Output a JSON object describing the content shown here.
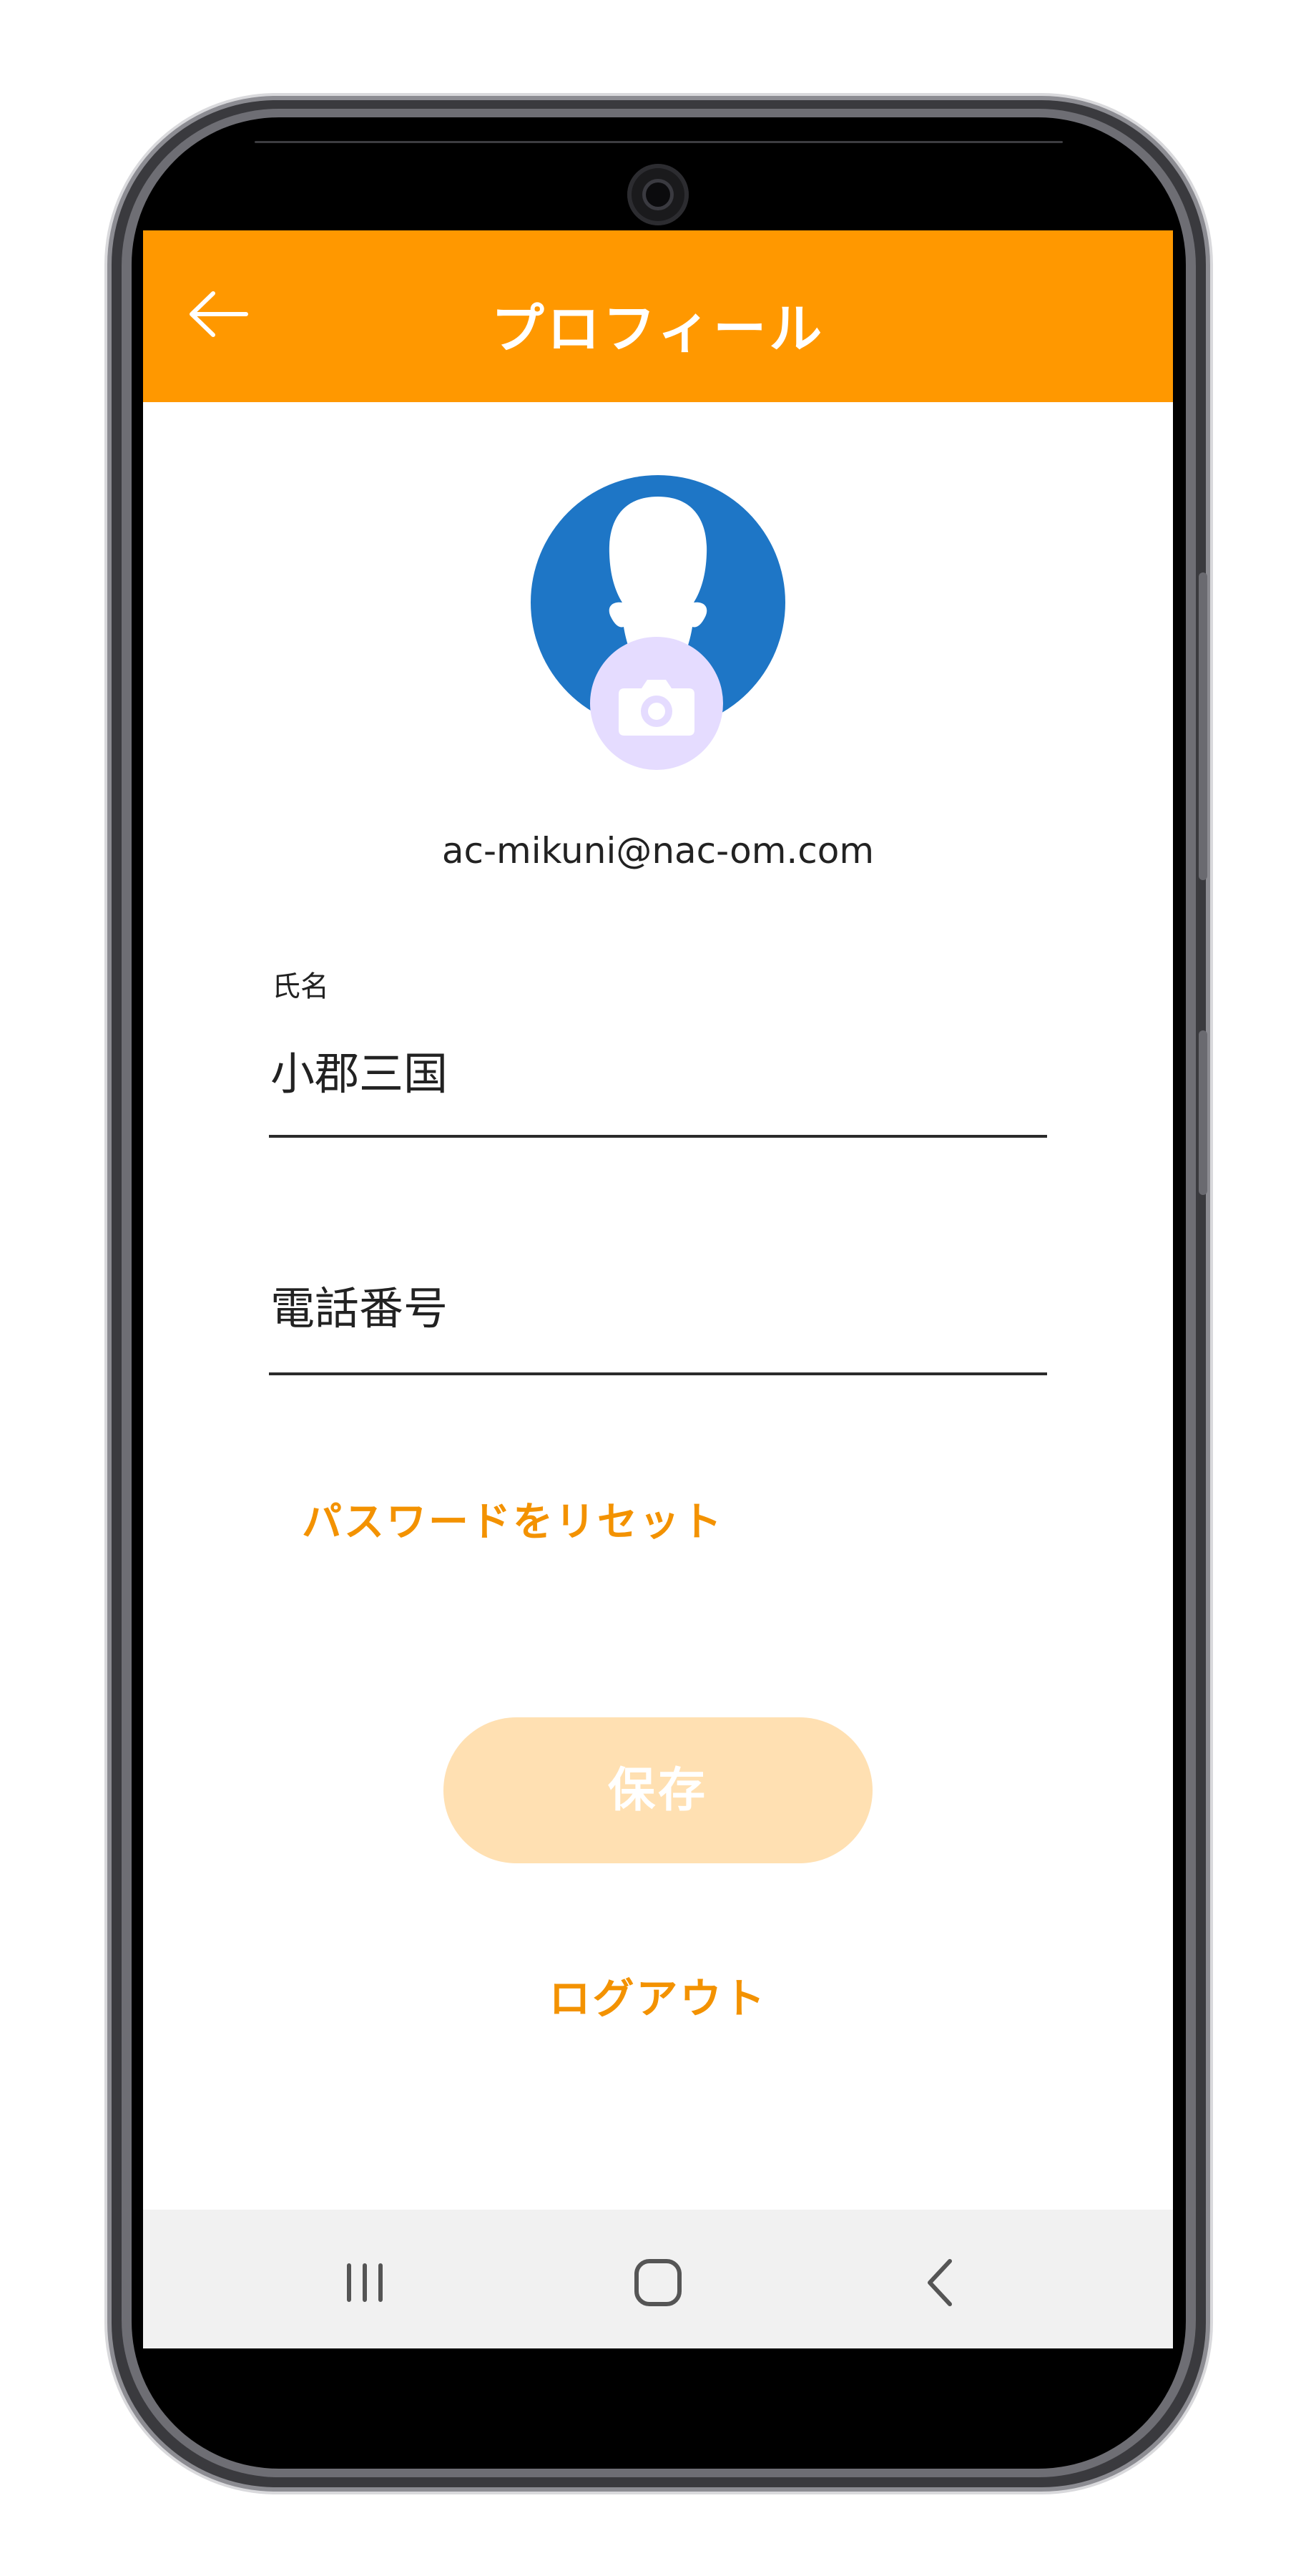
{
  "appbar": {
    "title": "プロフィール",
    "back_icon": "arrow-left-icon",
    "color": "#ff9800"
  },
  "profile": {
    "avatar_icon": "person-silhouette-icon",
    "avatar_color": "#1e76c6",
    "camera_icon": "camera-icon",
    "camera_badge_color": "#e5dcff",
    "email": "ac-mikuni@nac-om.com"
  },
  "form": {
    "name_label": "氏名",
    "name_value": "小郡三国",
    "phone_placeholder": "電話番号"
  },
  "actions": {
    "reset_password": "パスワードをリセット",
    "save": "保存",
    "logout": "ログアウト",
    "accent_color": "#f39200"
  },
  "navbar": {
    "recents_icon": "recents-icon",
    "home_icon": "home-icon",
    "back_icon": "chevron-left-icon"
  }
}
